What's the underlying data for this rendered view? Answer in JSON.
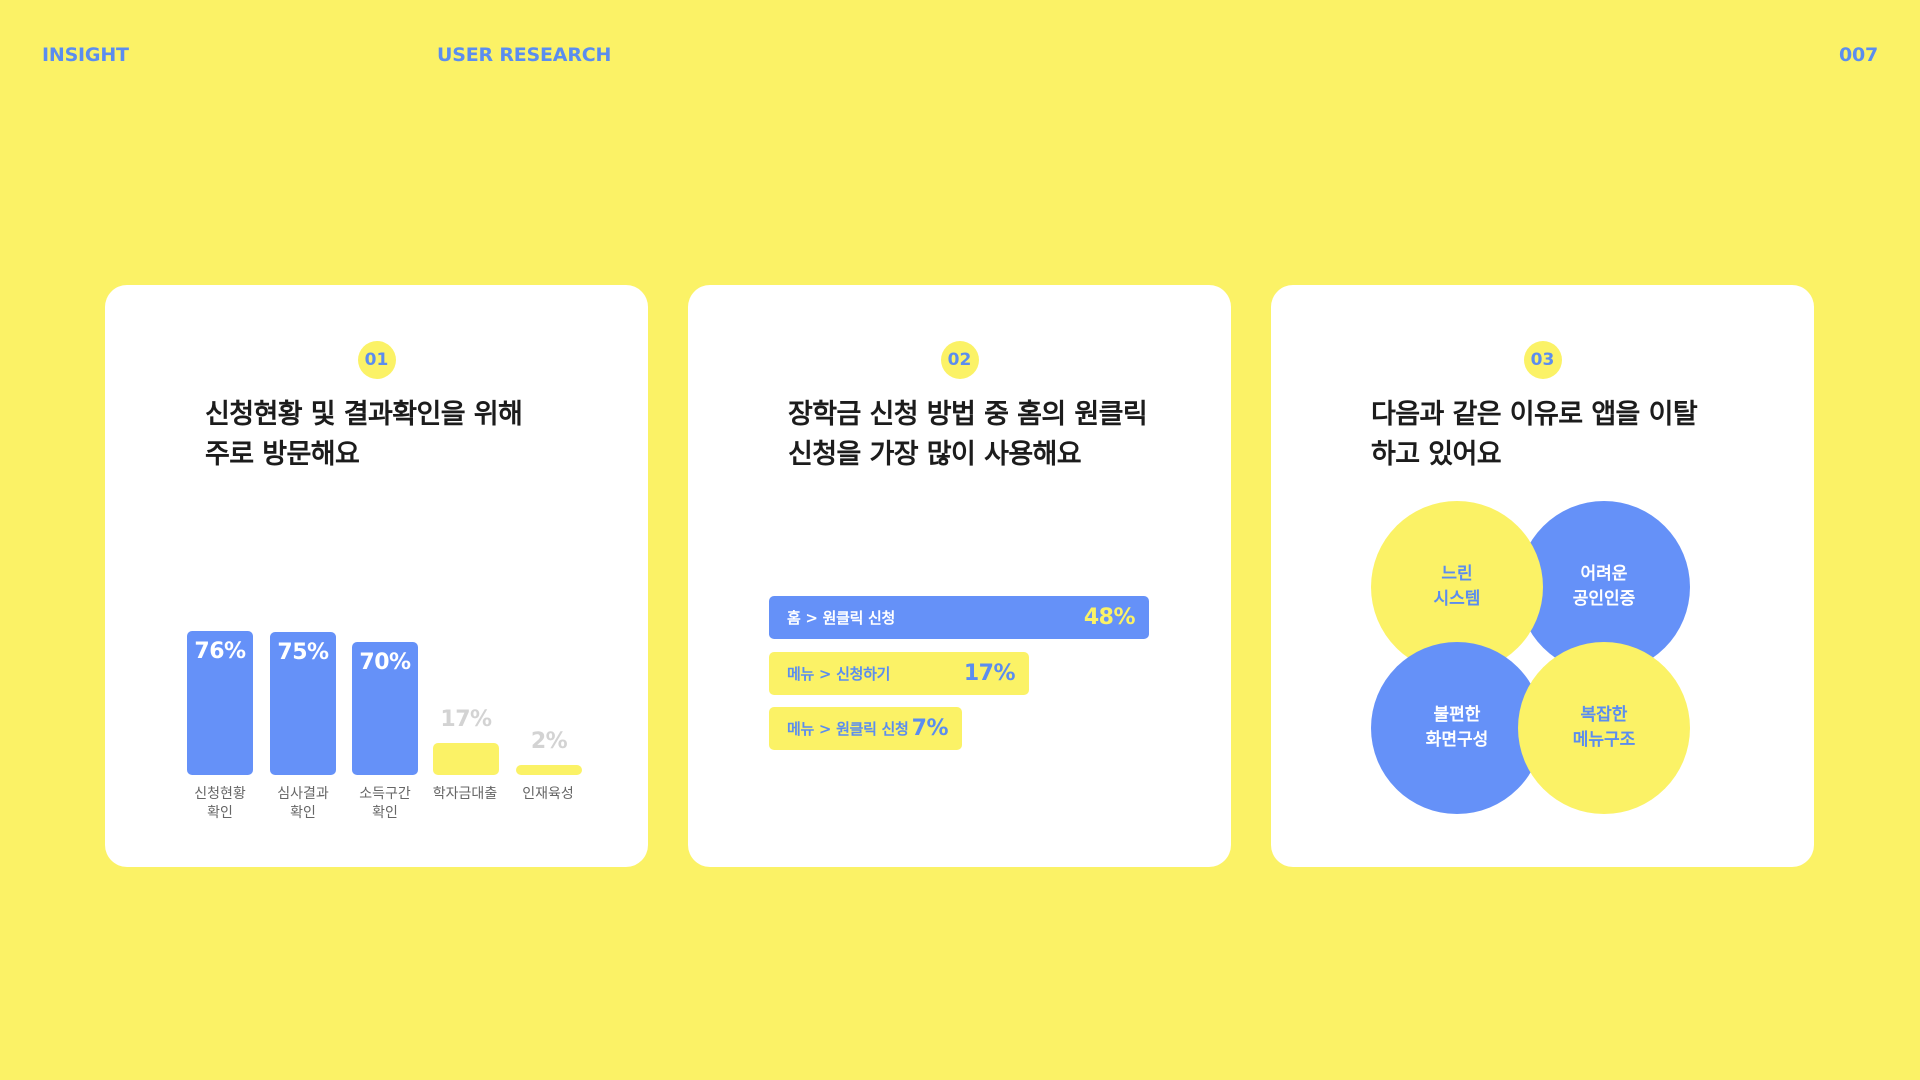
{
  "header": {
    "left": "INSIGHT",
    "middle": "USER RESEARCH",
    "page_number": "007"
  },
  "colors": {
    "background": "#FBF266",
    "accent_blue": "#6591F8",
    "header_text": "#5B8DEF",
    "card": "#FFFFFF"
  },
  "cards": [
    {
      "number": "01",
      "title_line1": "신청현황 및 결과확인을 위해",
      "title_line2": "주로 방문해요"
    },
    {
      "number": "02",
      "title_line1": "장학금 신청 방법 중 홈의 원클릭",
      "title_line2": "신청을 가장 많이 사용해요"
    },
    {
      "number": "03",
      "title_line1": "다음과 같은 이유로 앱을 이탈",
      "title_line2": "하고 있어요"
    }
  ],
  "chart_data": [
    {
      "type": "bar",
      "categories": [
        "신청현황\n확인",
        "심사결과\n확인",
        "소득구간\n확인",
        "학자금대출",
        "인재육성"
      ],
      "values": [
        76,
        75,
        70,
        17,
        2
      ],
      "value_labels": [
        "76%",
        "75%",
        "70%",
        "17%",
        "2%"
      ],
      "highlight": [
        true,
        true,
        true,
        false,
        false
      ],
      "ylim": [
        0,
        100
      ]
    },
    {
      "type": "bar",
      "orientation": "horizontal",
      "categories": [
        "홈 > 원클릭 신청",
        "메뉴 > 신청하기",
        "메뉴 > 원클릭 신청"
      ],
      "values": [
        48,
        17,
        7
      ],
      "value_labels": [
        "48%",
        "17%",
        "7%"
      ],
      "highlight": [
        true,
        false,
        false
      ]
    }
  ],
  "reasons": [
    {
      "label": "느린\n시스템",
      "color": "yellow"
    },
    {
      "label": "어려운\n공인인증",
      "color": "blue"
    },
    {
      "label": "불편한\n화면구성",
      "color": "blue"
    },
    {
      "label": "복잡한\n메뉴구조",
      "color": "yellow"
    }
  ]
}
